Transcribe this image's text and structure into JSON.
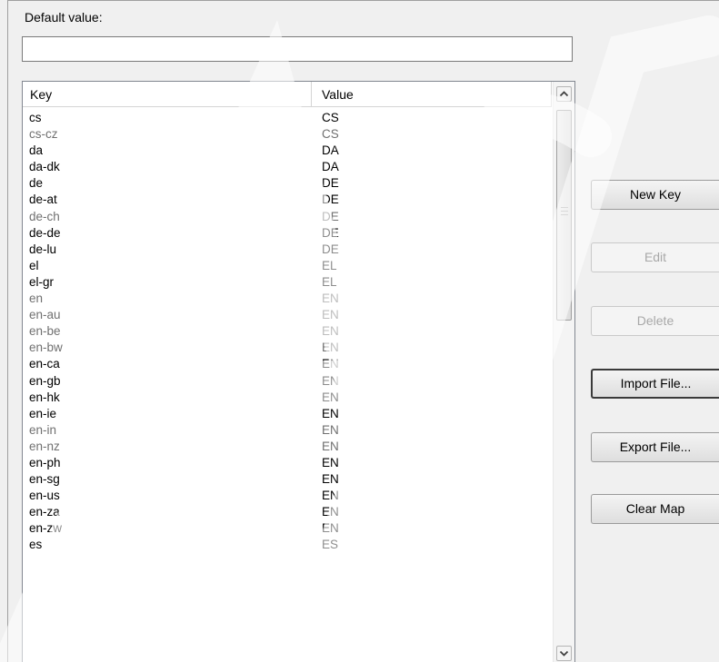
{
  "default_value": {
    "label": "Default value:",
    "value": ""
  },
  "table": {
    "columns": [
      "Key",
      "Value"
    ],
    "rows": [
      {
        "key": "cs",
        "value": "CS",
        "dim": false
      },
      {
        "key": "cs-cz",
        "value": "CS",
        "dim": true
      },
      {
        "key": "da",
        "value": "DA",
        "dim": false
      },
      {
        "key": "da-dk",
        "value": "DA",
        "dim": false
      },
      {
        "key": "de",
        "value": "DE",
        "dim": false
      },
      {
        "key": "de-at",
        "value": "DE",
        "dim": false
      },
      {
        "key": "de-ch",
        "value": "DE",
        "dim": true
      },
      {
        "key": "de-de",
        "value": "DE",
        "dim": false
      },
      {
        "key": "de-lu",
        "value": "DE",
        "dim": false
      },
      {
        "key": "el",
        "value": "EL",
        "dim": false
      },
      {
        "key": "el-gr",
        "value": "EL",
        "dim": false
      },
      {
        "key": "en",
        "value": "EN",
        "dim": true
      },
      {
        "key": "en-au",
        "value": "EN",
        "dim": true
      },
      {
        "key": "en-be",
        "value": "EN",
        "dim": true
      },
      {
        "key": "en-bw",
        "value": "EN",
        "dim": true
      },
      {
        "key": "en-ca",
        "value": "EN",
        "dim": false
      },
      {
        "key": "en-gb",
        "value": "EN",
        "dim": false
      },
      {
        "key": "en-hk",
        "value": "EN",
        "dim": false
      },
      {
        "key": "en-ie",
        "value": "EN",
        "dim": false
      },
      {
        "key": "en-in",
        "value": "EN",
        "dim": true
      },
      {
        "key": "en-nz",
        "value": "EN",
        "dim": true
      },
      {
        "key": "en-ph",
        "value": "EN",
        "dim": false
      },
      {
        "key": "en-sg",
        "value": "EN",
        "dim": false
      },
      {
        "key": "en-us",
        "value": "EN",
        "dim": false
      },
      {
        "key": "en-za",
        "value": "EN",
        "dim": false
      },
      {
        "key": "en-zw",
        "value": "EN",
        "dim": false
      },
      {
        "key": "es",
        "value": "ES",
        "dim": false
      }
    ]
  },
  "buttons": {
    "new_key": "New Key",
    "edit": "Edit",
    "delete": "Delete",
    "import_file": "Import File...",
    "export_file": "Export File...",
    "clear_map": "Clear Map"
  },
  "icons": {
    "scroll_up": "chevron-up-icon",
    "scroll_down": "chevron-down-icon"
  },
  "colors": {
    "background": "#f0f0f0",
    "disabled_text": "#a8a8a8",
    "watermark": "#e8e8e8"
  }
}
